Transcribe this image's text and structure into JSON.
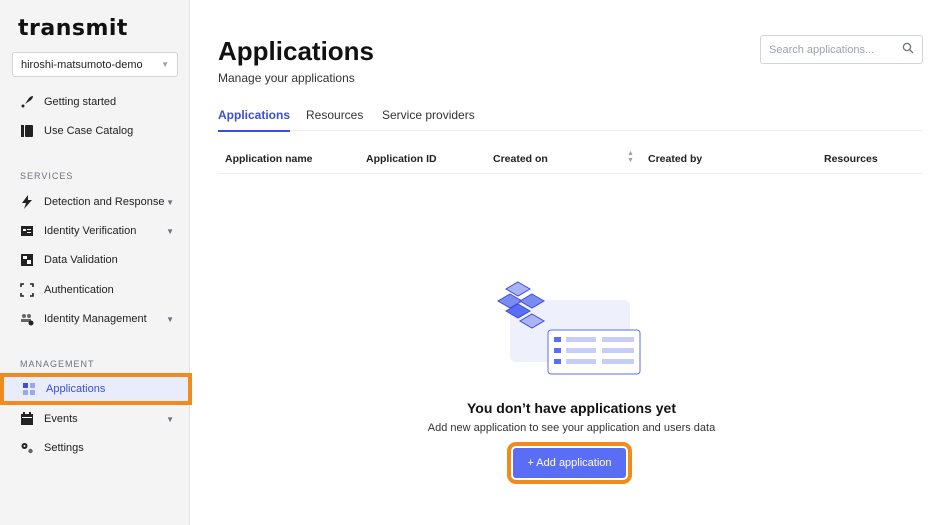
{
  "app": {
    "logo_text": "transmit"
  },
  "sidebar": {
    "environment": "hiroshi-matsumoto-demo",
    "top_items": [
      {
        "label": "Getting started",
        "icon": "rocket-icon"
      },
      {
        "label": "Use Case Catalog",
        "icon": "catalog-icon"
      }
    ],
    "services_label": "SERVICES",
    "services": [
      {
        "label": "Detection and Response",
        "icon": "bolt-icon",
        "expandable": true
      },
      {
        "label": "Identity Verification",
        "icon": "id-card-icon",
        "expandable": true
      },
      {
        "label": "Data Validation",
        "icon": "data-validation-icon",
        "expandable": false
      },
      {
        "label": "Authentication",
        "icon": "scan-frame-icon",
        "expandable": false
      },
      {
        "label": "Identity Management",
        "icon": "users-gear-icon",
        "expandable": true
      }
    ],
    "management_label": "MANAGEMENT",
    "management": [
      {
        "label": "Applications",
        "icon": "grid-icon",
        "active": true
      },
      {
        "label": "Events",
        "icon": "calendar-icon",
        "expandable": true
      },
      {
        "label": "Settings",
        "icon": "gears-icon"
      }
    ]
  },
  "main": {
    "title": "Applications",
    "subtitle": "Manage your applications",
    "search_placeholder": "Search applications...",
    "tabs": [
      "Applications",
      "Resources",
      "Service providers"
    ],
    "active_tab": "Applications",
    "columns": [
      "Application name",
      "Application ID",
      "Created on",
      "Created by",
      "Resources"
    ],
    "empty_title": "You don’t have applications yet",
    "empty_subtitle": "Add new application to see your application and users data",
    "add_button": "+ Add application"
  },
  "colors": {
    "accent": "#3b4fd8",
    "button": "#5a6ef5",
    "highlight": "#f28b1d"
  }
}
